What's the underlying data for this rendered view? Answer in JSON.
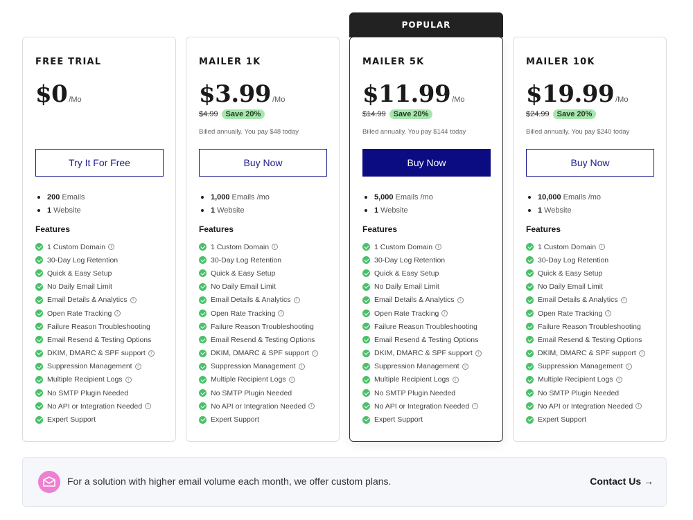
{
  "popular_label": "POPULAR",
  "plans": [
    {
      "name": "FREE TRIAL",
      "price": "$0",
      "per": "/Mo",
      "original_price": "",
      "save": "",
      "billed": "",
      "cta": "Try It For Free",
      "quota": [
        {
          "count": "200",
          "label": "Emails"
        },
        {
          "count": "1",
          "label": "Website"
        }
      ]
    },
    {
      "name": "MAILER 1K",
      "price": "$3.99",
      "per": "/Mo",
      "original_price": "$4.99",
      "save": "Save 20%",
      "billed": "Billed annually. You pay $48 today",
      "cta": "Buy Now",
      "quota": [
        {
          "count": "1,000",
          "label": "Emails /mo"
        },
        {
          "count": "1",
          "label": "Website"
        }
      ]
    },
    {
      "name": "MAILER 5K",
      "price": "$11.99",
      "per": "/Mo",
      "original_price": "$14.99",
      "save": "Save 20%",
      "billed": "Billed annually. You pay $144 today",
      "cta": "Buy Now",
      "quota": [
        {
          "count": "5,000",
          "label": "Emails /mo"
        },
        {
          "count": "1",
          "label": "Website"
        }
      ]
    },
    {
      "name": "MAILER 10K",
      "price": "$19.99",
      "per": "/Mo",
      "original_price": "$24.99",
      "save": "Save 20%",
      "billed": "Billed annually. You pay $240 today",
      "cta": "Buy Now",
      "quota": [
        {
          "count": "10,000",
          "label": "Emails /mo"
        },
        {
          "count": "1",
          "label": "Website"
        }
      ]
    }
  ],
  "features_title": "Features",
  "features": [
    {
      "label": "1 Custom Domain",
      "info": true
    },
    {
      "label": "30-Day Log Retention",
      "info": false
    },
    {
      "label": "Quick & Easy Setup",
      "info": false
    },
    {
      "label": "No Daily Email Limit",
      "info": false
    },
    {
      "label": "Email Details & Analytics",
      "info": true
    },
    {
      "label": "Open Rate Tracking",
      "info": true
    },
    {
      "label": "Failure Reason Troubleshooting",
      "info": false
    },
    {
      "label": "Email Resend & Testing Options",
      "info": false
    },
    {
      "label": "DKIM, DMARC & SPF support",
      "info": true
    },
    {
      "label": "Suppression Management",
      "info": true
    },
    {
      "label": "Multiple Recipient Logs",
      "info": true
    },
    {
      "label": "No SMTP Plugin Needed",
      "info": false
    },
    {
      "label": "No API or Integration Needed",
      "info": true
    },
    {
      "label": "Expert Support",
      "info": false
    }
  ],
  "custom_plan": {
    "text": "For a solution with higher email volume each month, we offer custom plans.",
    "contact": "Contact Us →"
  },
  "colors": {
    "primary": "#0b0b82",
    "check": "#49c169",
    "save_badge": "#a8e6b0",
    "icon_bg": "#ef7fd0"
  }
}
